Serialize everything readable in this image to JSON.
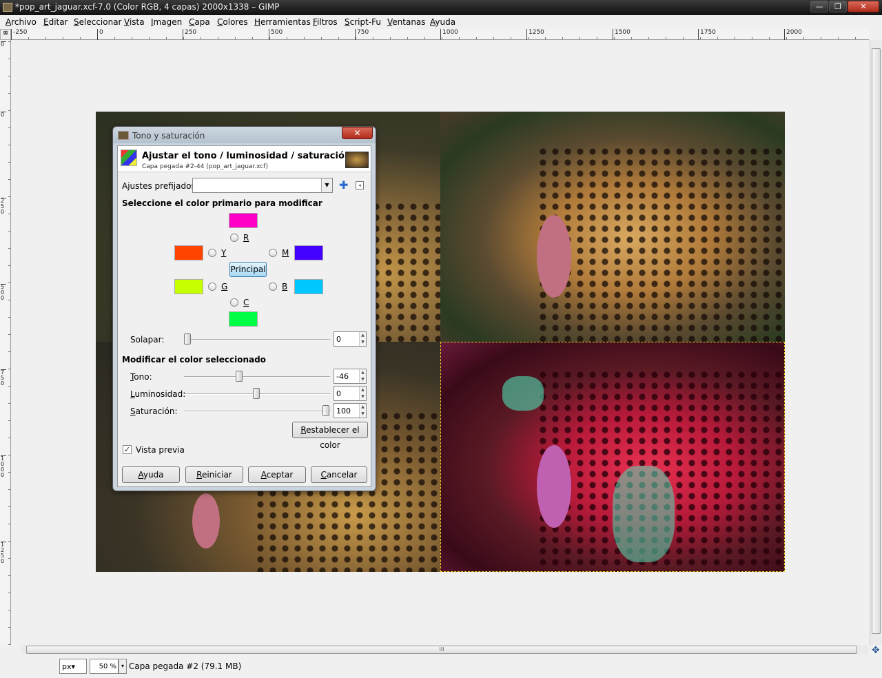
{
  "window": {
    "title": "*pop_art_jaguar.xcf-7.0 (Color RGB, 4 capas) 2000x1338 – GIMP",
    "buttons": {
      "minimize": "—",
      "maximize": "❐",
      "close": "✕"
    }
  },
  "menu": [
    "Archivo",
    "Editar",
    "Seleccionar",
    "Vista",
    "Imagen",
    "Capa",
    "Colores",
    "Herramientas",
    "Filtros",
    "Script-Fu",
    "Ventanas",
    "Ayuda"
  ],
  "ruler": {
    "top_ticks": [
      "-250",
      "0",
      "250",
      "500",
      "750",
      "1000",
      "1250",
      "1500",
      "1750",
      "2000"
    ],
    "left_ticks": [
      "0",
      "0",
      "250",
      "500",
      "750",
      "1000",
      "1250"
    ]
  },
  "dialog": {
    "title": "Tono y saturación",
    "close": "✕",
    "header_title": "Ajustar el tono / luminosidad / saturación",
    "header_subtitle": "Capa pegada #2-44 (pop_art_jaguar.xcf)",
    "presets_label": "Ajustes prefijados:",
    "presets_value": "",
    "select_color_heading": "Seleccione el color primario para modificar",
    "colors": {
      "R": {
        "label": "R",
        "swatch": "#ff00c8"
      },
      "Y": {
        "label": "Y",
        "swatch": "#ff4400"
      },
      "M": {
        "label": "M",
        "swatch": "#4400ff"
      },
      "G": {
        "label": "G",
        "swatch": "#c8ff00"
      },
      "B": {
        "label": "B",
        "swatch": "#00c8ff"
      },
      "C": {
        "label": "C",
        "swatch": "#00ff44"
      }
    },
    "principal_label": "Principal",
    "overlap_label": "Solapar:",
    "overlap_value": "0",
    "modify_heading": "Modificar el color seleccionado",
    "hue_label": "Tono:",
    "hue_value": "-46",
    "lightness_label": "Luminosidad:",
    "lightness_value": "0",
    "saturation_label": "Saturación:",
    "saturation_value": "100",
    "reset_color_label": "Restablecer el color",
    "preview_label": "Vista previa",
    "preview_checked": "✓",
    "buttons": {
      "help": "Ayuda",
      "reset": "Reiniciar",
      "ok": "Aceptar",
      "cancel": "Cancelar"
    }
  },
  "status": {
    "unit": "px▾",
    "zoom": "50 %",
    "zoom_arrow": "▾",
    "layer_info": "Capa pegada #2 (79.1 MB)"
  },
  "scroll": {
    "grip": "III",
    "nav": "✥"
  }
}
